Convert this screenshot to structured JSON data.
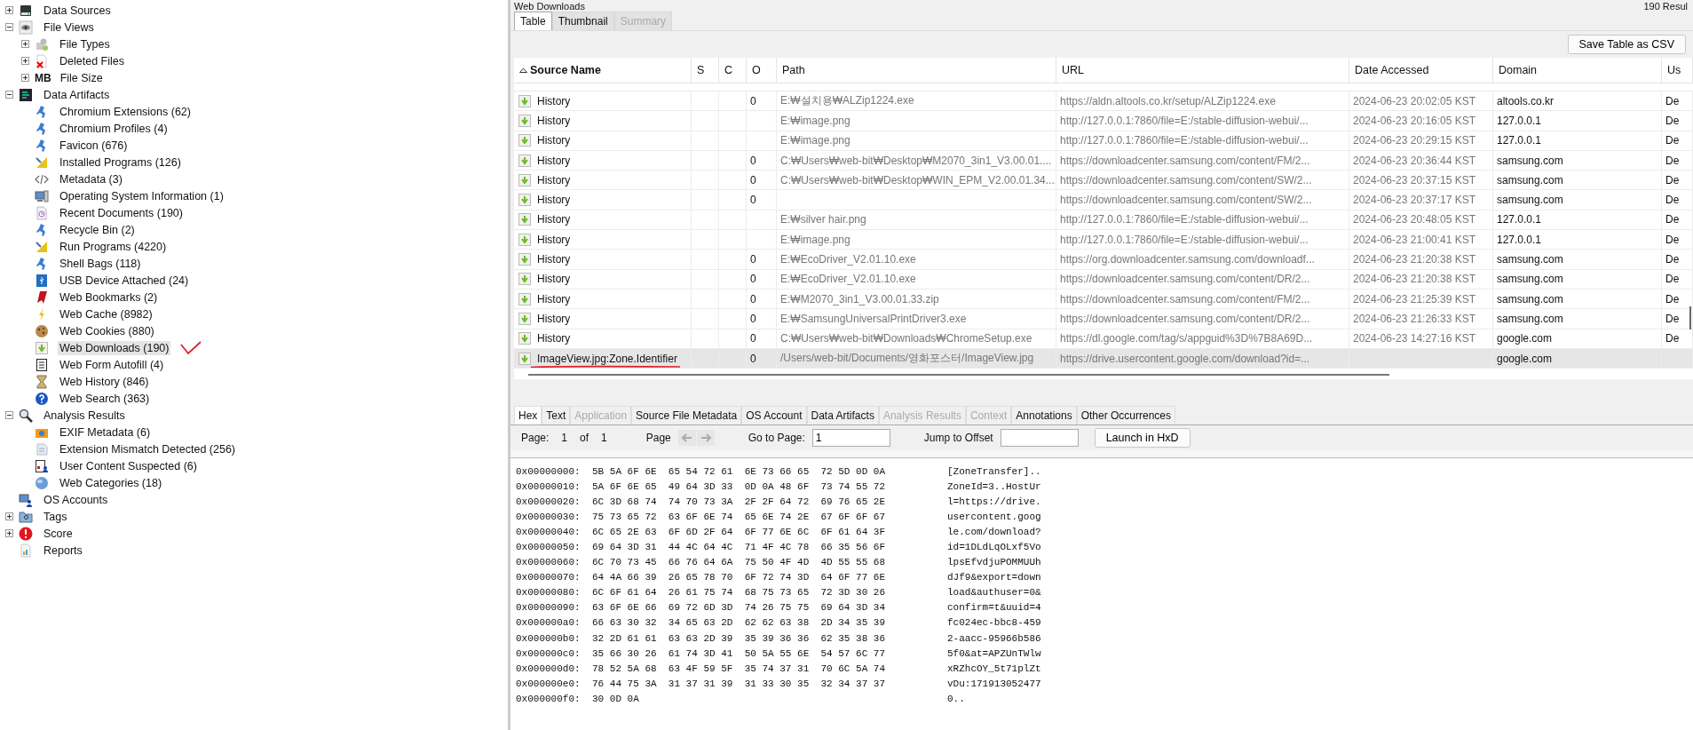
{
  "tree": [
    {
      "label": "Data Sources",
      "kind": "disk",
      "expanded": false
    },
    {
      "label": "File Views",
      "kind": "eye",
      "expanded": true,
      "children": [
        {
          "label": "File Types",
          "kind": "filetypes",
          "expanded": false
        },
        {
          "label": "Deleted Files",
          "kind": "deleted",
          "expanded": false
        },
        {
          "label": "File Size",
          "kind": "size",
          "icon_text": "MB",
          "expanded": false
        }
      ]
    },
    {
      "label": "Data Artifacts",
      "kind": "artifacts",
      "expanded": true,
      "children": [
        {
          "label": "Chromium Extensions (62)",
          "kind": "chromium"
        },
        {
          "label": "Chromium Profiles (4)",
          "kind": "chromium"
        },
        {
          "label": "Favicon (676)",
          "kind": "chromium"
        },
        {
          "label": "Installed Programs (126)",
          "kind": "setsquare"
        },
        {
          "label": "Metadata (3)",
          "kind": "code"
        },
        {
          "label": "Operating System Information (1)",
          "kind": "computer"
        },
        {
          "label": "Recent Documents (190)",
          "kind": "recent"
        },
        {
          "label": "Recycle Bin (2)",
          "kind": "chromium"
        },
        {
          "label": "Run Programs (4220)",
          "kind": "setsquare"
        },
        {
          "label": "Shell Bags (118)",
          "kind": "chromium"
        },
        {
          "label": "USB Device Attached (24)",
          "kind": "usb"
        },
        {
          "label": "Web Bookmarks (2)",
          "kind": "bookmark"
        },
        {
          "label": "Web Cache (8982)",
          "kind": "bolt"
        },
        {
          "label": "Web Cookies (880)",
          "kind": "cookie"
        },
        {
          "label": "Web Downloads (190)",
          "kind": "download",
          "selected": true
        },
        {
          "label": "Web Form Autofill (4)",
          "kind": "form"
        },
        {
          "label": "Web History (846)",
          "kind": "hourglass"
        },
        {
          "label": "Web Search (363)",
          "kind": "help"
        }
      ]
    },
    {
      "label": "Analysis Results",
      "kind": "magnifier",
      "expanded": true,
      "children": [
        {
          "label": "EXIF Metadata (6)",
          "kind": "camera"
        },
        {
          "label": "Extension Mismatch Detected (256)",
          "kind": "mismatch"
        },
        {
          "label": "User Content Suspected (6)",
          "kind": "usercontent"
        },
        {
          "label": "Web Categories (18)",
          "kind": "globe"
        }
      ]
    },
    {
      "label": "OS Accounts",
      "kind": "accounts"
    },
    {
      "label": "Tags",
      "kind": "tag",
      "expanded": false
    },
    {
      "label": "Score",
      "kind": "score",
      "expanded": false
    },
    {
      "label": "Reports",
      "kind": "reports"
    }
  ],
  "viewer": {
    "title": "Web Downloads",
    "result_count": "190  Resul",
    "tabs": [
      {
        "label": "Table",
        "selected": true,
        "disabled": false
      },
      {
        "label": "Thumbnail",
        "selected": false,
        "disabled": false
      },
      {
        "label": "Summary",
        "selected": false,
        "disabled": true
      }
    ],
    "save_button": "Save Table as CSV"
  },
  "table": {
    "columns": [
      "Source Name",
      "S",
      "C",
      "O",
      "Path",
      "URL",
      "Date Accessed",
      "Domain",
      "Us"
    ],
    "rows": [
      {
        "source": "History",
        "o": "0",
        "path": "E:₩설치용₩ALZip1224.exe",
        "url": "https://aldn.altools.co.kr/setup/ALZip1224.exe",
        "date": "2024-06-23 20:02:05 KST",
        "domain": "altools.co.kr",
        "column_9": "De",
        "selected": false
      },
      {
        "source": "History",
        "path": "E:₩image.png",
        "url": "http://127.0.0.1:7860/file=E:/stable-diffusion-webui/...",
        "date": "2024-06-23 20:16:05 KST",
        "domain": "127.0.0.1",
        "column_9": "De",
        "selected": false
      },
      {
        "source": "History",
        "path": "E:₩image.png",
        "url": "http://127.0.0.1:7860/file=E:/stable-diffusion-webui/...",
        "date": "2024-06-23 20:29:15 KST",
        "domain": "127.0.0.1",
        "column_9": "De",
        "selected": false
      },
      {
        "source": "History",
        "o": "0",
        "path": "C:₩Users₩web-bit₩Desktop₩M2070_3in1_V3.00.01....",
        "url": "https://downloadcenter.samsung.com/content/FM/2...",
        "date": "2024-06-23 20:36:44 KST",
        "domain": "samsung.com",
        "column_9": "De",
        "selected": false
      },
      {
        "source": "History",
        "o": "0",
        "path": "C:₩Users₩web-bit₩Desktop₩WIN_EPM_V2.00.01.34....",
        "url": "https://downloadcenter.samsung.com/content/SW/2...",
        "date": "2024-06-23 20:37:15 KST",
        "domain": "samsung.com",
        "column_9": "De",
        "selected": false
      },
      {
        "source": "History",
        "o": "0",
        "url": "https://downloadcenter.samsung.com/content/SW/2...",
        "date": "2024-06-23 20:37:17 KST",
        "domain": "samsung.com",
        "column_9": "De",
        "selected": false
      },
      {
        "source": "History",
        "path": "E:₩silver hair.png",
        "url": "http://127.0.0.1:7860/file=E:/stable-diffusion-webui/...",
        "date": "2024-06-23 20:48:05 KST",
        "domain": "127.0.0.1",
        "column_9": "De",
        "selected": false
      },
      {
        "source": "History",
        "path": "E:₩image.png",
        "url": "http://127.0.0.1:7860/file=E:/stable-diffusion-webui/...",
        "date": "2024-06-23 21:00:41 KST",
        "domain": "127.0.0.1",
        "column_9": "De",
        "selected": false
      },
      {
        "source": "History",
        "o": "0",
        "path": "E:₩EcoDriver_V2.01.10.exe",
        "url": "https://org.downloadcenter.samsung.com/downloadf...",
        "date": "2024-06-23 21:20:38 KST",
        "domain": "samsung.com",
        "column_9": "De",
        "selected": false
      },
      {
        "source": "History",
        "o": "0",
        "path": "E:₩EcoDriver_V2.01.10.exe",
        "url": "https://downloadcenter.samsung.com/content/DR/2...",
        "date": "2024-06-23 21:20:38 KST",
        "domain": "samsung.com",
        "column_9": "De",
        "selected": false
      },
      {
        "source": "History",
        "o": "0",
        "path": "E:₩M2070_3in1_V3.00.01.33.zip",
        "url": "https://downloadcenter.samsung.com/content/FM/2...",
        "date": "2024-06-23 21:25:39 KST",
        "domain": "samsung.com",
        "column_9": "De",
        "selected": false
      },
      {
        "source": "History",
        "o": "0",
        "path": "E:₩SamsungUniversalPrintDriver3.exe",
        "url": "https://downloadcenter.samsung.com/content/DR/2...",
        "date": "2024-06-23 21:26:33 KST",
        "domain": "samsung.com",
        "column_9": "De",
        "selected": false
      },
      {
        "source": "History",
        "o": "0",
        "path": "C:₩Users₩web-bit₩Downloads₩ChromeSetup.exe",
        "url": "https://dl.google.com/tag/s/appguid%3D%7B8A69D...",
        "date": "2024-06-23 14:27:16 KST",
        "domain": "google.com",
        "column_9": "De",
        "selected": false
      },
      {
        "source": "ImageView.jpg:Zone.Identifier",
        "o": "0",
        "path": "/Users/web-bit/Documents/영화포스터/ImageView.jpg",
        "url": "https://drive.usercontent.google.com/download?id=...",
        "domain": "google.com",
        "selected": true
      }
    ]
  },
  "content_tabs": [
    {
      "label": "Hex",
      "selected": true,
      "disabled": false
    },
    {
      "label": "Text",
      "selected": false,
      "disabled": false
    },
    {
      "label": "Application",
      "selected": false,
      "disabled": true
    },
    {
      "label": "Source File Metadata",
      "selected": false,
      "disabled": false
    },
    {
      "label": "OS Account",
      "selected": false,
      "disabled": false
    },
    {
      "label": "Data Artifacts",
      "selected": false,
      "disabled": false
    },
    {
      "label": "Analysis Results",
      "selected": false,
      "disabled": true
    },
    {
      "label": "Context",
      "selected": false,
      "disabled": true
    },
    {
      "label": "Annotations",
      "selected": false,
      "disabled": false
    },
    {
      "label": "Other Occurrences",
      "selected": false,
      "disabled": false
    }
  ],
  "hex_toolbar": {
    "page_label": "Page:",
    "page": "1",
    "of_label": "of",
    "page_count": "1",
    "nav_label": "Page",
    "goto_label": "Go to Page:",
    "goto_value": "1",
    "offset_label": "Jump to Offset",
    "launch_button": "Launch in HxD"
  },
  "hex_lines": [
    {
      "offset": "0x00000000:",
      "hex": "5B 5A 6F 6E  65 54 72 61  6E 73 66 65  72 5D 0D 0A",
      "ascii": "[ZoneTransfer].."
    },
    {
      "offset": "0x00000010:",
      "hex": "5A 6F 6E 65  49 64 3D 33  0D 0A 48 6F  73 74 55 72",
      "ascii": "ZoneId=3..HostUr"
    },
    {
      "offset": "0x00000020:",
      "hex": "6C 3D 68 74  74 70 73 3A  2F 2F 64 72  69 76 65 2E",
      "ascii": "l=https://drive."
    },
    {
      "offset": "0x00000030:",
      "hex": "75 73 65 72  63 6F 6E 74  65 6E 74 2E  67 6F 6F 67",
      "ascii": "usercontent.goog"
    },
    {
      "offset": "0x00000040:",
      "hex": "6C 65 2E 63  6F 6D 2F 64  6F 77 6E 6C  6F 61 64 3F",
      "ascii": "le.com/download?"
    },
    {
      "offset": "0x00000050:",
      "hex": "69 64 3D 31  44 4C 64 4C  71 4F 4C 78  66 35 56 6F",
      "ascii": "id=1DLdLqOLxf5Vo"
    },
    {
      "offset": "0x00000060:",
      "hex": "6C 70 73 45  66 76 64 6A  75 50 4F 4D  4D 55 55 68",
      "ascii": "lpsEfvdjuPOMMUUh"
    },
    {
      "offset": "0x00000070:",
      "hex": "64 4A 66 39  26 65 78 70  6F 72 74 3D  64 6F 77 6E",
      "ascii": "dJf9&export=down"
    },
    {
      "offset": "0x00000080:",
      "hex": "6C 6F 61 64  26 61 75 74  68 75 73 65  72 3D 30 26",
      "ascii": "load&authuser=0&"
    },
    {
      "offset": "0x00000090:",
      "hex": "63 6F 6E 66  69 72 6D 3D  74 26 75 75  69 64 3D 34",
      "ascii": "confirm=t&uuid=4"
    },
    {
      "offset": "0x000000a0:",
      "hex": "66 63 30 32  34 65 63 2D  62 62 63 38  2D 34 35 39",
      "ascii": "fc024ec-bbc8-459"
    },
    {
      "offset": "0x000000b0:",
      "hex": "32 2D 61 61  63 63 2D 39  35 39 36 36  62 35 38 36",
      "ascii": "2-aacc-95966b586"
    },
    {
      "offset": "0x000000c0:",
      "hex": "35 66 30 26  61 74 3D 41  50 5A 55 6E  54 57 6C 77",
      "ascii": "5f0&at=APZUnTWlw"
    },
    {
      "offset": "0x000000d0:",
      "hex": "78 52 5A 68  63 4F 59 5F  35 74 37 31  70 6C 5A 74",
      "ascii": "xRZhcOY_5t71plZt"
    },
    {
      "offset": "0x000000e0:",
      "hex": "76 44 75 3A  31 37 31 39  31 33 30 35  32 34 37 37",
      "ascii": "vDu:171913052477"
    },
    {
      "offset": "0x000000f0:",
      "hex": "30 0D 0A",
      "ascii": "0.."
    }
  ]
}
